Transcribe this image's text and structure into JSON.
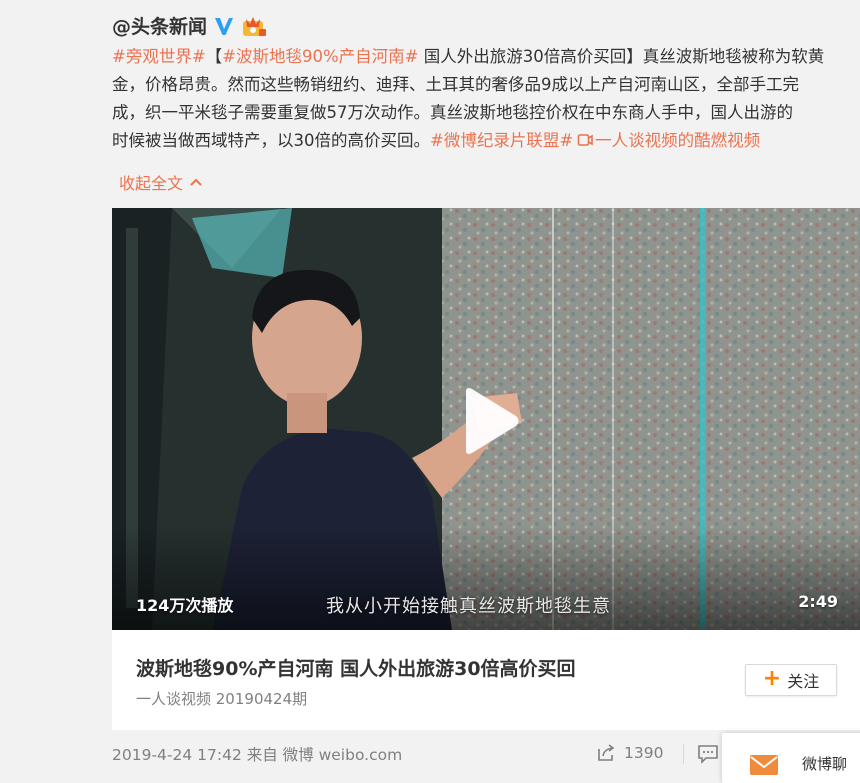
{
  "author": {
    "name": "@头条新闻"
  },
  "post": {
    "l1_tag1": "#旁观世界#",
    "l1_bracket_open": "【",
    "l1_tag2": "#波斯地毯90%产自河南#",
    "l1_text": " 国人外出旅游30倍高价买回】真丝波斯地毯被称为软黄",
    "l2_text": "金，价格昂贵。然而这些畅销纽约、迪拜、土耳其的奢侈品9成以上产自河南山区，全部手工完",
    "l3_text": "成，织一平米毯子需要重复做57万次动作。真丝波斯地毯控价权在中东商人手中，国人出游的",
    "l4_text": "时候被当做西域特产，以30倍的高价买回。",
    "l4_tag": "#微博纪录片联盟#",
    "l4_link": "一人谈视频的酷燃视频",
    "collapse": "收起全文"
  },
  "video": {
    "play_count": "124万次播放",
    "subtitle": "我从小开始接触真丝波斯地毯生意",
    "duration": "2:49"
  },
  "card": {
    "title": "波斯地毯90%产自河南 国人外出旅游30倍高价买回",
    "source": "一人谈视频 20190424期",
    "follow": "关注"
  },
  "footer": {
    "timestamp": "2019-4-24 17:42 来自 ",
    "source": "微博 weibo.com",
    "share_count": "1390"
  },
  "chat": {
    "label": "微博聊"
  },
  "colors": {
    "accent": "#eb7350",
    "follow_plus": "#ff8200",
    "verified": "#2c9ff0"
  },
  "icons": [
    "verified-icon",
    "crown-icon",
    "link-icon",
    "chevron-up-icon",
    "play-icon",
    "plus-icon",
    "share-icon",
    "comment-icon",
    "mail-icon"
  ]
}
